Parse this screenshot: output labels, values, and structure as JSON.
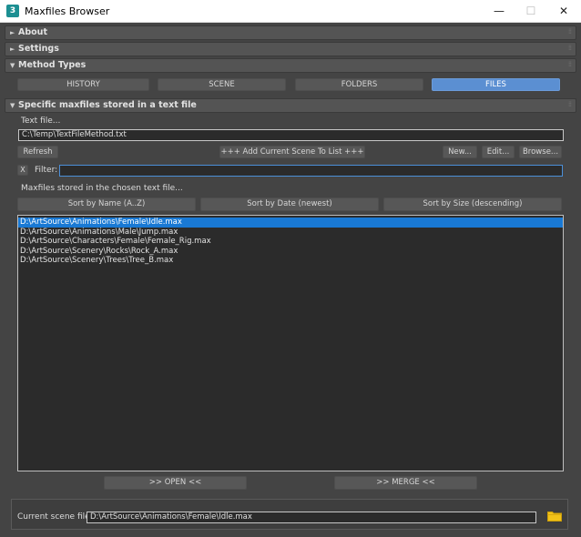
{
  "window": {
    "title": "Maxfiles Browser",
    "app_icon": "3",
    "minimize_glyph": "—",
    "maximize_glyph": "☐",
    "close_glyph": "✕"
  },
  "rollouts": {
    "about": "About",
    "settings": "Settings",
    "method_types": "Method Types",
    "specific": "Specific maxfiles stored in a text file",
    "collapsed_glyph": "►",
    "expanded_glyph": "▼",
    "grip_glyph": "⁞⁞"
  },
  "method_tabs": [
    {
      "label": "HISTORY",
      "active": false
    },
    {
      "label": "SCENE",
      "active": false
    },
    {
      "label": "FOLDERS",
      "active": false
    },
    {
      "label": "FILES",
      "active": true
    }
  ],
  "text_file": {
    "label": "Text file...",
    "value": "C:\\Temp\\TextFileMethod.txt"
  },
  "toolbar": {
    "refresh": "Refresh",
    "add_current": "+++   Add Current Scene To List   +++",
    "new": "New...",
    "edit": "Edit...",
    "browse": "Browse..."
  },
  "filter": {
    "clear": "X",
    "label": "Filter:",
    "value": ""
  },
  "list_label": "Maxfiles stored in the chosen text file...",
  "sort": {
    "by_name": "Sort by Name (A..Z)",
    "by_date": "Sort by Date (newest)",
    "by_size": "Sort by Size (descending)"
  },
  "files": [
    "D:\\ArtSource\\Animations\\Female\\Idle.max",
    "D:\\ArtSource\\Animations\\Male\\Jump.max",
    "D:\\ArtSource\\Characters\\Female\\Female_Rig.max",
    "D:\\ArtSource\\Scenery\\Rocks\\Rock_A.max",
    "D:\\ArtSource\\Scenery\\Trees\\Tree_B.max"
  ],
  "selected_index": 0,
  "actions": {
    "open": ">>   OPEN   <<",
    "merge": ">>   MERGE   <<"
  },
  "current_scene": {
    "label": "Current scene file:",
    "value": "D:\\ArtSource\\Animations\\Female\\Idle.max"
  },
  "colors": {
    "accent": "#5b8fd2",
    "selection": "#1979d4",
    "folder": "#f2c219"
  }
}
